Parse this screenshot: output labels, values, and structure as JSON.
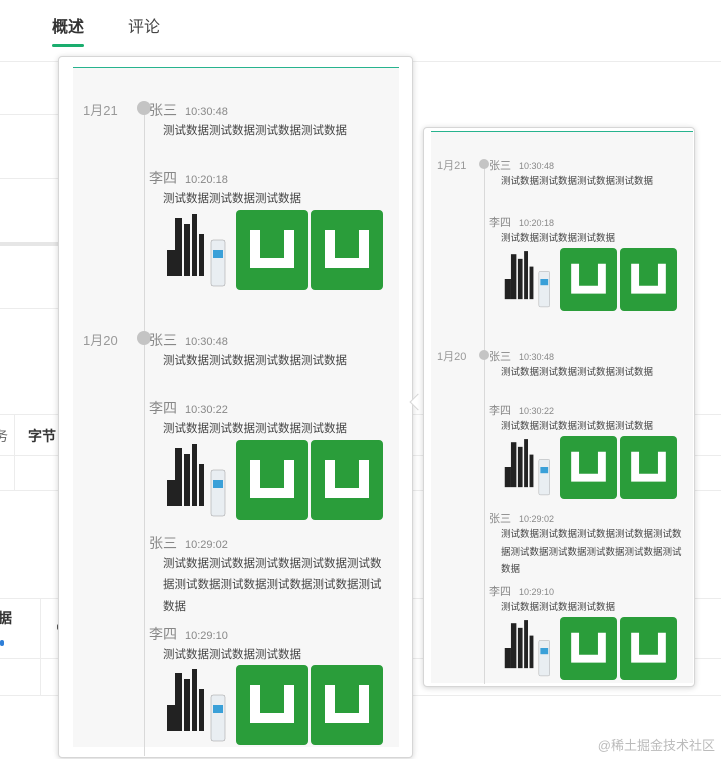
{
  "tabs": [
    {
      "label": "概述",
      "active": true
    },
    {
      "label": "评论",
      "active": false
    }
  ],
  "background": {
    "partial_char": "务",
    "column_header": "字节",
    "partial_header": "据"
  },
  "timeline_large": {
    "groups": [
      {
        "date": "1月21",
        "entries": [
          {
            "author": "张三",
            "time": "10:30:48",
            "message": "测试数据测试数据测试数据测试数据",
            "has_images": false
          },
          {
            "author": "李四",
            "time": "10:20:18",
            "message": "测试数据测试数据测试数据",
            "has_images": true
          }
        ]
      },
      {
        "date": "1月20",
        "entries": [
          {
            "author": "张三",
            "time": "10:30:48",
            "message": "测试数据测试数据测试数据测试数据",
            "has_images": false
          },
          {
            "author": "李四",
            "time": "10:30:22",
            "message": "测试数据测试数据测试数据测试数据",
            "has_images": true
          },
          {
            "author": "张三",
            "time": "10:29:02",
            "message": "测试数据测试数据测试数据测试数据测试数据测试数据测试数据测试数据测试数据测试数据",
            "has_images": false
          },
          {
            "author": "李四",
            "time": "10:29:10",
            "message": "测试数据测试数据测试数据",
            "has_images": true
          }
        ]
      }
    ]
  },
  "timeline_small": {
    "groups": [
      {
        "date": "1月21",
        "entries": [
          {
            "author": "张三",
            "time": "10:30:48",
            "message": "测试数据测试数据测试数据测试数据",
            "has_images": false
          },
          {
            "author": "李四",
            "time": "10:20:18",
            "message": "测试数据测试数据测试数据",
            "has_images": true
          }
        ]
      },
      {
        "date": "1月20",
        "entries": [
          {
            "author": "张三",
            "time": "10:30:48",
            "message": "测试数据测试数据测试数据测试数据",
            "has_images": false
          },
          {
            "author": "李四",
            "time": "10:30:22",
            "message": "测试数据测试数据测试数据测试数据",
            "has_images": true
          },
          {
            "author": "张三",
            "time": "10:29:02",
            "message": "测试数据测试数据测试数据测试数据测试数据测试数据测试数据测试数据测试数据测试数据",
            "has_images": false
          },
          {
            "author": "李四",
            "time": "10:29:10",
            "message": "测试数据测试数据测试数据",
            "has_images": true
          }
        ]
      }
    ]
  },
  "watermark": "@稀土掘金技术社区",
  "colors": {
    "accent": "#1aad6e",
    "thumb_green": "#2a9d3a",
    "timeline": "#d9d9d9"
  }
}
